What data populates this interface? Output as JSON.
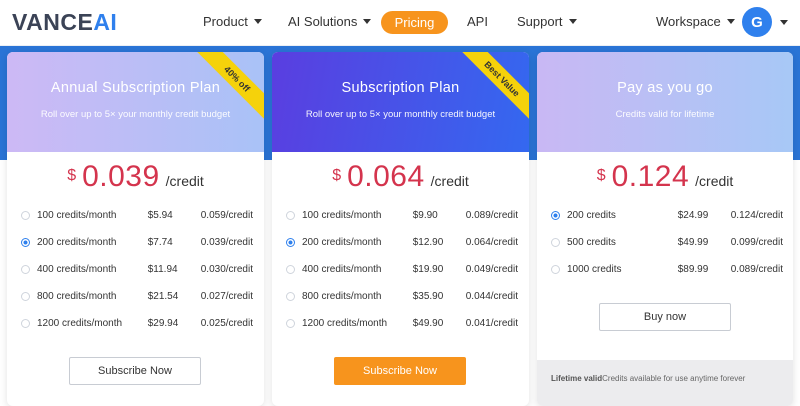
{
  "nav": {
    "logo_main": "VANCE",
    "logo_ai": "AI",
    "items": [
      {
        "label": "Product"
      },
      {
        "label": "AI Solutions"
      },
      {
        "label": "Pricing"
      },
      {
        "label": "API"
      },
      {
        "label": "Support"
      },
      {
        "label": "Workspace"
      }
    ],
    "avatar_initial": "G"
  },
  "colors": {
    "brand_blue": "#2f80ed",
    "accent_orange": "#f7941d",
    "price_red": "#d4344d",
    "badge_yellow": "#f5d20b"
  },
  "plans": [
    {
      "title": "Annual Subscription Plan",
      "subtitle": "Roll over up to 5× your monthly credit budget",
      "badge": "40% off",
      "currency": "$",
      "price": "0.039",
      "unit": "/credit",
      "options": [
        {
          "credits": "100 credits/month",
          "price": "$5.94",
          "per": "0.059/credit",
          "selected": false
        },
        {
          "credits": "200 credits/month",
          "price": "$7.74",
          "per": "0.039/credit",
          "selected": true
        },
        {
          "credits": "400 credits/month",
          "price": "$11.94",
          "per": "0.030/credit",
          "selected": false
        },
        {
          "credits": "800 credits/month",
          "price": "$21.54",
          "per": "0.027/credit",
          "selected": false
        },
        {
          "credits": "1200 credits/month",
          "price": "$29.94",
          "per": "0.025/credit",
          "selected": false
        }
      ],
      "button": "Subscribe Now"
    },
    {
      "title": "Subscription Plan",
      "subtitle": "Roll over up to 5× your monthly credit budget",
      "badge": "Best Value",
      "currency": "$",
      "price": "0.064",
      "unit": "/credit",
      "options": [
        {
          "credits": "100 credits/month",
          "price": "$9.90",
          "per": "0.089/credit",
          "selected": false
        },
        {
          "credits": "200 credits/month",
          "price": "$12.90",
          "per": "0.064/credit",
          "selected": true
        },
        {
          "credits": "400 credits/month",
          "price": "$19.90",
          "per": "0.049/credit",
          "selected": false
        },
        {
          "credits": "800 credits/month",
          "price": "$35.90",
          "per": "0.044/credit",
          "selected": false
        },
        {
          "credits": "1200 credits/month",
          "price": "$49.90",
          "per": "0.041/credit",
          "selected": false
        }
      ],
      "button": "Subscribe Now"
    },
    {
      "title": "Pay as you go",
      "subtitle": "Credits valid for lifetime",
      "currency": "$",
      "price": "0.124",
      "unit": "/credit",
      "options": [
        {
          "credits": "200 credits",
          "price": "$24.99",
          "per": "0.124/credit",
          "selected": true
        },
        {
          "credits": "500 credits",
          "price": "$49.99",
          "per": "0.099/credit",
          "selected": false
        },
        {
          "credits": "1000 credits",
          "price": "$89.99",
          "per": "0.089/credit",
          "selected": false
        }
      ],
      "button": "Buy now",
      "footer_bold": "Lifetime valid",
      "footer_text": "Credits available for use anytime forever"
    }
  ]
}
